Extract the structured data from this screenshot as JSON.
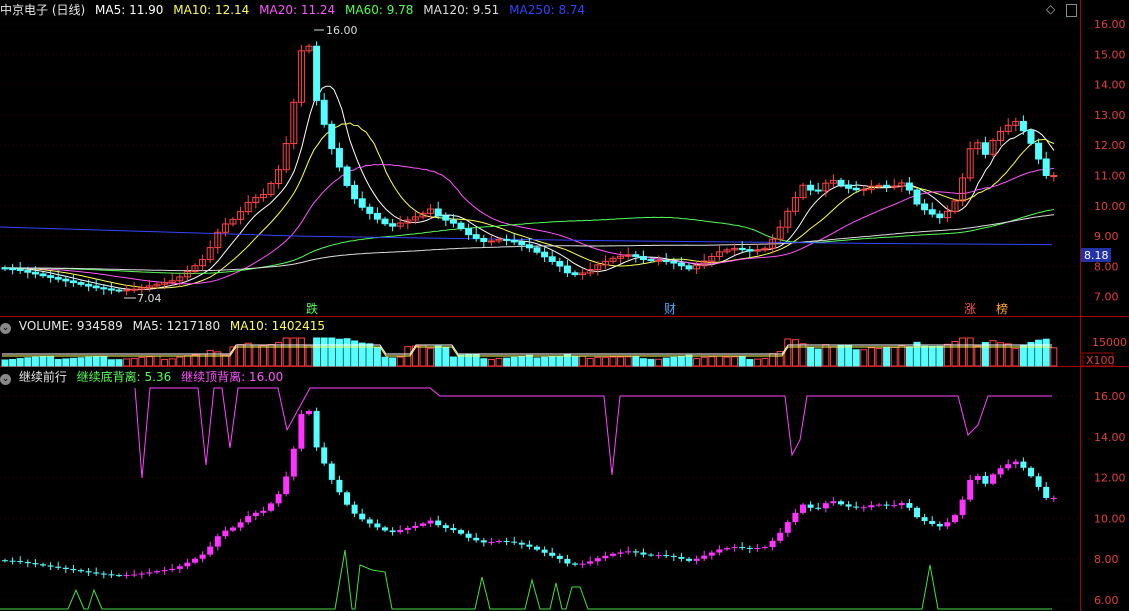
{
  "main_panel": {
    "title": "中京电子 (日线)",
    "indicators": [
      {
        "name": "MA5",
        "label": "MA5: 11.90",
        "color": "#ffffff"
      },
      {
        "name": "MA10",
        "label": "MA10: 12.14",
        "color": "#ffff55"
      },
      {
        "name": "MA20",
        "label": "MA20: 11.24",
        "color": "#ff55ff"
      },
      {
        "name": "MA60",
        "label": "MA60: 9.78",
        "color": "#55ff55"
      },
      {
        "name": "MA120",
        "label": "MA120: 9.51",
        "color": "#dddddd"
      },
      {
        "name": "MA250",
        "label": "MA250: 8.74",
        "color": "#3344ff"
      }
    ],
    "y_ticks": [
      "16.00",
      "15.00",
      "14.00",
      "13.00",
      "12.00",
      "11.00",
      "10.00",
      "9.00",
      "8.00",
      "7.00"
    ],
    "high_label": "16.00",
    "low_label": "7.04",
    "current_price": "8.18",
    "markers": [
      {
        "text": "跌",
        "color": "#55ff55"
      },
      {
        "text": "财",
        "color": "#55aaff"
      },
      {
        "text": "涨",
        "color": "#ff5555"
      },
      {
        "text": "榜",
        "color": "#ffaa33"
      }
    ],
    "buttons": {
      "diamond": "◇",
      "menu": "▯"
    }
  },
  "volume_panel": {
    "title": "VOLUME: 934589",
    "ma5": "MA5: 1217180",
    "ma10": "MA10: 1402415",
    "y_tick": "15000",
    "unit": "X100"
  },
  "indicator_panel": {
    "title": "继续前行",
    "bottom_div": "继续底背离: 5.36",
    "top_div": "继续顶背离: 16.00",
    "y_ticks": [
      "16.00",
      "14.00",
      "12.00",
      "10.00",
      "8.00",
      "6.00"
    ]
  },
  "colors": {
    "up": "#ff4444",
    "down": "#55ffff",
    "grid": "#6b0000",
    "axis": "#aa0000"
  }
}
